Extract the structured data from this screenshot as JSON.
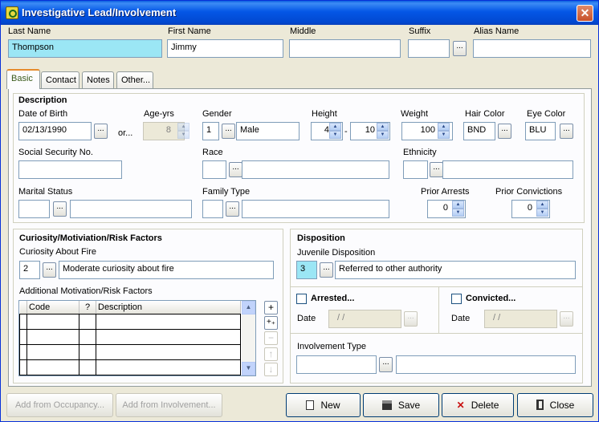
{
  "window": {
    "title": "Investigative Lead/Involvement"
  },
  "header": {
    "last_name_label": "Last Name",
    "last_name_value": "Thompson",
    "first_name_label": "First Name",
    "first_name_value": "Jimmy",
    "middle_label": "Middle",
    "middle_value": "",
    "suffix_label": "Suffix",
    "suffix_value": "",
    "alias_label": "Alias Name",
    "alias_value": ""
  },
  "tabs": [
    "Basic",
    "Contact",
    "Notes",
    "Other..."
  ],
  "description": {
    "title": "Description",
    "dob_label": "Date of Birth",
    "dob_value": "02/13/1990",
    "or_text": "or...",
    "age_label": "Age-yrs",
    "age_value": "8",
    "gender_label": "Gender",
    "gender_code": "1",
    "gender_value": "Male",
    "height_label": "Height",
    "height_ft": "4",
    "height_sep": "-",
    "height_in": "10",
    "weight_label": "Weight",
    "weight_value": "100",
    "hair_label": "Hair Color",
    "hair_value": "BND",
    "eye_label": "Eye Color",
    "eye_value": "BLU",
    "ssn_label": "Social Security No.",
    "ssn_value": "",
    "race_label": "Race",
    "race_code": "",
    "race_value": "",
    "ethnicity_label": "Ethnicity",
    "ethnicity_code": "",
    "ethnicity_value": "",
    "marital_label": "Marital Status",
    "marital_code": "",
    "marital_value": "",
    "family_label": "Family Type",
    "family_code": "",
    "family_value": "",
    "prior_arrests_label": "Prior Arrests",
    "prior_arrests_value": "0",
    "prior_convictions_label": "Prior Convictions",
    "prior_convictions_value": "0"
  },
  "curiosity": {
    "title": "Curiosity/Motiviation/Risk Factors",
    "about_fire_label": "Curiosity About Fire",
    "about_fire_code": "2",
    "about_fire_value": "Moderate curiosity about fire",
    "additional_label": "Additional Motivation/Risk Factors",
    "columns": [
      "Code",
      "?",
      "Description"
    ]
  },
  "disposition": {
    "title": "Disposition",
    "juvenile_label": "Juvenile Disposition",
    "juvenile_code": "3",
    "juvenile_value": "Referred to other authority",
    "arrested_label": "Arrested...",
    "convicted_label": "Convicted...",
    "date_label": "Date",
    "date_placeholder": "/ /",
    "involvement_label": "Involvement Type",
    "involvement_code": "",
    "involvement_value": ""
  },
  "buttons": {
    "add_occupancy": "Add from Occupancy...",
    "add_involvement": "Add from Involvement...",
    "new": "New",
    "save": "Save",
    "delete": "Delete",
    "close": "Close"
  },
  "icons": {
    "ellipsis": "...",
    "plus": "+",
    "plus_plus": "+₊",
    "minus": "−",
    "up": "↑",
    "down": "↓"
  }
}
